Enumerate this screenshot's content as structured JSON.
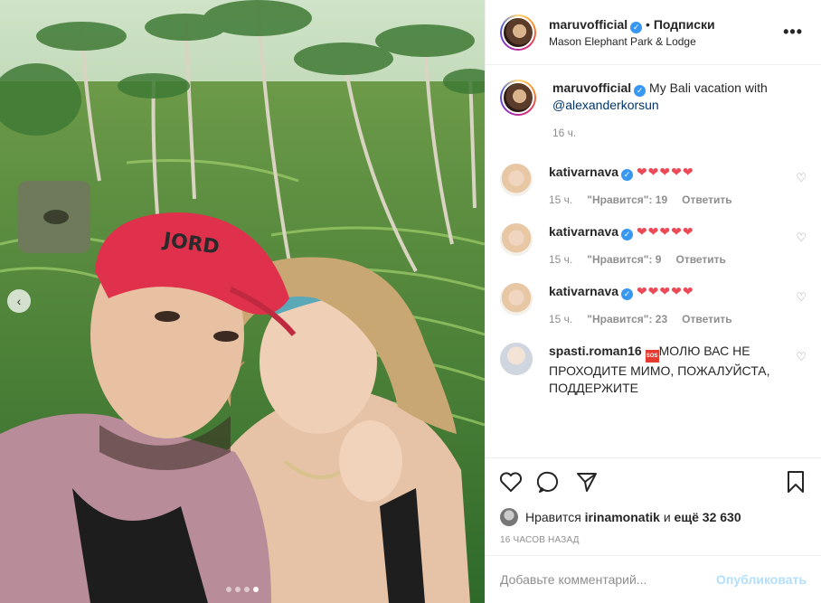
{
  "post": {
    "username": "maruvofficial",
    "follow_label": "Подписки",
    "separator": "•",
    "location": "Mason Elephant Park & Lodge",
    "more_label": "•••"
  },
  "caption": {
    "username": "maruvofficial",
    "text": "My Bali vacation with",
    "mention": "@alexanderkorsun",
    "time": "16 ч."
  },
  "comments": [
    {
      "username": "kativarnava",
      "text": "❤❤❤❤❤",
      "time": "15 ч.",
      "likes": "\"Нравится\": 19",
      "reply": "Ответить"
    },
    {
      "username": "kativarnava",
      "text": "❤❤❤❤❤",
      "time": "15 ч.",
      "likes": "\"Нравится\": 9",
      "reply": "Ответить"
    },
    {
      "username": "kativarnava",
      "text": "❤❤❤❤❤",
      "time": "15 ч.",
      "likes": "\"Нравится\": 23",
      "reply": "Ответить"
    },
    {
      "username": "spasti.roman16",
      "sos": "SOS",
      "text": "МОЛЮ ВАС НЕ ПРОХОДИТЕ МИМО, ПОЖАЛУЙСТА, ПОДДЕРЖИТЕ"
    }
  ],
  "likes": {
    "prefix": "Нравится",
    "user": "irinamonatik",
    "middle": "и",
    "rest": "ещё 32 630"
  },
  "timestamp": "16 ЧАСОВ НАЗАД",
  "add_comment": {
    "placeholder": "Добавьте комментарий...",
    "publish_label": "Опубликовать"
  },
  "carousel": {
    "total": 4,
    "active": 4
  },
  "icons": [
    "chevron-left-icon",
    "verified-icon",
    "more-icon",
    "heart-icon",
    "comment-icon",
    "share-icon",
    "bookmark-icon"
  ],
  "colors": {
    "verified": "#3897f0",
    "link": "#00376b",
    "heart": "#ed4956",
    "publish": "#b2dffc"
  }
}
